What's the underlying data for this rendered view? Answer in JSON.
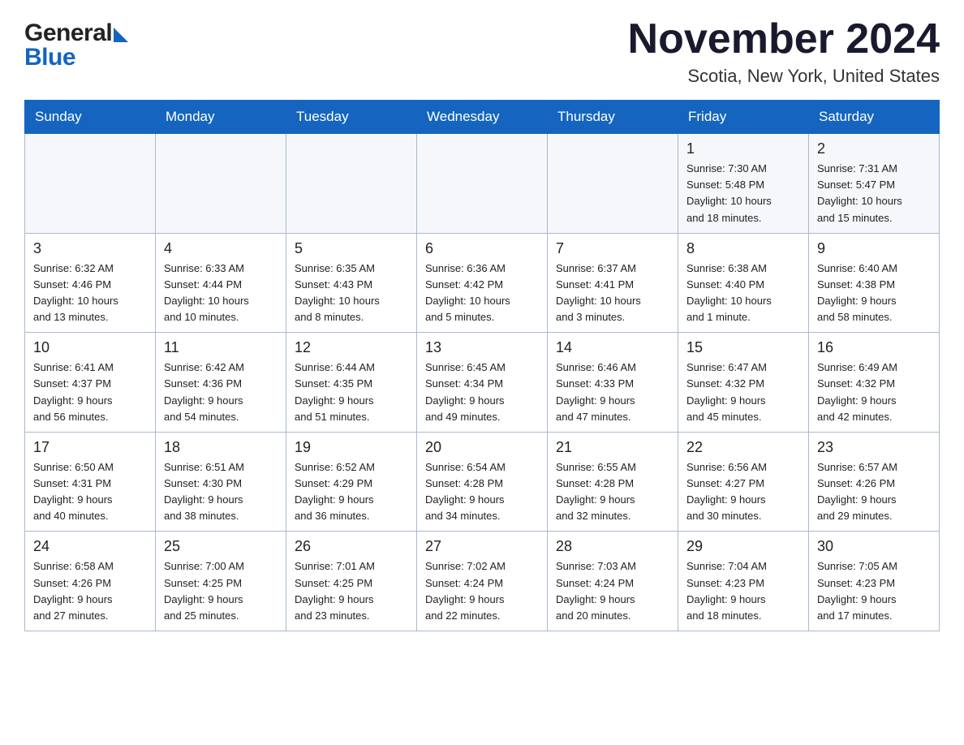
{
  "header": {
    "logo_general": "General",
    "logo_blue": "Blue",
    "month_title": "November 2024",
    "location": "Scotia, New York, United States"
  },
  "calendar": {
    "days_of_week": [
      "Sunday",
      "Monday",
      "Tuesday",
      "Wednesday",
      "Thursday",
      "Friday",
      "Saturday"
    ],
    "weeks": [
      [
        {
          "day": "",
          "info": ""
        },
        {
          "day": "",
          "info": ""
        },
        {
          "day": "",
          "info": ""
        },
        {
          "day": "",
          "info": ""
        },
        {
          "day": "",
          "info": ""
        },
        {
          "day": "1",
          "info": "Sunrise: 7:30 AM\nSunset: 5:48 PM\nDaylight: 10 hours\nand 18 minutes."
        },
        {
          "day": "2",
          "info": "Sunrise: 7:31 AM\nSunset: 5:47 PM\nDaylight: 10 hours\nand 15 minutes."
        }
      ],
      [
        {
          "day": "3",
          "info": "Sunrise: 6:32 AM\nSunset: 4:46 PM\nDaylight: 10 hours\nand 13 minutes."
        },
        {
          "day": "4",
          "info": "Sunrise: 6:33 AM\nSunset: 4:44 PM\nDaylight: 10 hours\nand 10 minutes."
        },
        {
          "day": "5",
          "info": "Sunrise: 6:35 AM\nSunset: 4:43 PM\nDaylight: 10 hours\nand 8 minutes."
        },
        {
          "day": "6",
          "info": "Sunrise: 6:36 AM\nSunset: 4:42 PM\nDaylight: 10 hours\nand 5 minutes."
        },
        {
          "day": "7",
          "info": "Sunrise: 6:37 AM\nSunset: 4:41 PM\nDaylight: 10 hours\nand 3 minutes."
        },
        {
          "day": "8",
          "info": "Sunrise: 6:38 AM\nSunset: 4:40 PM\nDaylight: 10 hours\nand 1 minute."
        },
        {
          "day": "9",
          "info": "Sunrise: 6:40 AM\nSunset: 4:38 PM\nDaylight: 9 hours\nand 58 minutes."
        }
      ],
      [
        {
          "day": "10",
          "info": "Sunrise: 6:41 AM\nSunset: 4:37 PM\nDaylight: 9 hours\nand 56 minutes."
        },
        {
          "day": "11",
          "info": "Sunrise: 6:42 AM\nSunset: 4:36 PM\nDaylight: 9 hours\nand 54 minutes."
        },
        {
          "day": "12",
          "info": "Sunrise: 6:44 AM\nSunset: 4:35 PM\nDaylight: 9 hours\nand 51 minutes."
        },
        {
          "day": "13",
          "info": "Sunrise: 6:45 AM\nSunset: 4:34 PM\nDaylight: 9 hours\nand 49 minutes."
        },
        {
          "day": "14",
          "info": "Sunrise: 6:46 AM\nSunset: 4:33 PM\nDaylight: 9 hours\nand 47 minutes."
        },
        {
          "day": "15",
          "info": "Sunrise: 6:47 AM\nSunset: 4:32 PM\nDaylight: 9 hours\nand 45 minutes."
        },
        {
          "day": "16",
          "info": "Sunrise: 6:49 AM\nSunset: 4:32 PM\nDaylight: 9 hours\nand 42 minutes."
        }
      ],
      [
        {
          "day": "17",
          "info": "Sunrise: 6:50 AM\nSunset: 4:31 PM\nDaylight: 9 hours\nand 40 minutes."
        },
        {
          "day": "18",
          "info": "Sunrise: 6:51 AM\nSunset: 4:30 PM\nDaylight: 9 hours\nand 38 minutes."
        },
        {
          "day": "19",
          "info": "Sunrise: 6:52 AM\nSunset: 4:29 PM\nDaylight: 9 hours\nand 36 minutes."
        },
        {
          "day": "20",
          "info": "Sunrise: 6:54 AM\nSunset: 4:28 PM\nDaylight: 9 hours\nand 34 minutes."
        },
        {
          "day": "21",
          "info": "Sunrise: 6:55 AM\nSunset: 4:28 PM\nDaylight: 9 hours\nand 32 minutes."
        },
        {
          "day": "22",
          "info": "Sunrise: 6:56 AM\nSunset: 4:27 PM\nDaylight: 9 hours\nand 30 minutes."
        },
        {
          "day": "23",
          "info": "Sunrise: 6:57 AM\nSunset: 4:26 PM\nDaylight: 9 hours\nand 29 minutes."
        }
      ],
      [
        {
          "day": "24",
          "info": "Sunrise: 6:58 AM\nSunset: 4:26 PM\nDaylight: 9 hours\nand 27 minutes."
        },
        {
          "day": "25",
          "info": "Sunrise: 7:00 AM\nSunset: 4:25 PM\nDaylight: 9 hours\nand 25 minutes."
        },
        {
          "day": "26",
          "info": "Sunrise: 7:01 AM\nSunset: 4:25 PM\nDaylight: 9 hours\nand 23 minutes."
        },
        {
          "day": "27",
          "info": "Sunrise: 7:02 AM\nSunset: 4:24 PM\nDaylight: 9 hours\nand 22 minutes."
        },
        {
          "day": "28",
          "info": "Sunrise: 7:03 AM\nSunset: 4:24 PM\nDaylight: 9 hours\nand 20 minutes."
        },
        {
          "day": "29",
          "info": "Sunrise: 7:04 AM\nSunset: 4:23 PM\nDaylight: 9 hours\nand 18 minutes."
        },
        {
          "day": "30",
          "info": "Sunrise: 7:05 AM\nSunset: 4:23 PM\nDaylight: 9 hours\nand 17 minutes."
        }
      ]
    ]
  }
}
